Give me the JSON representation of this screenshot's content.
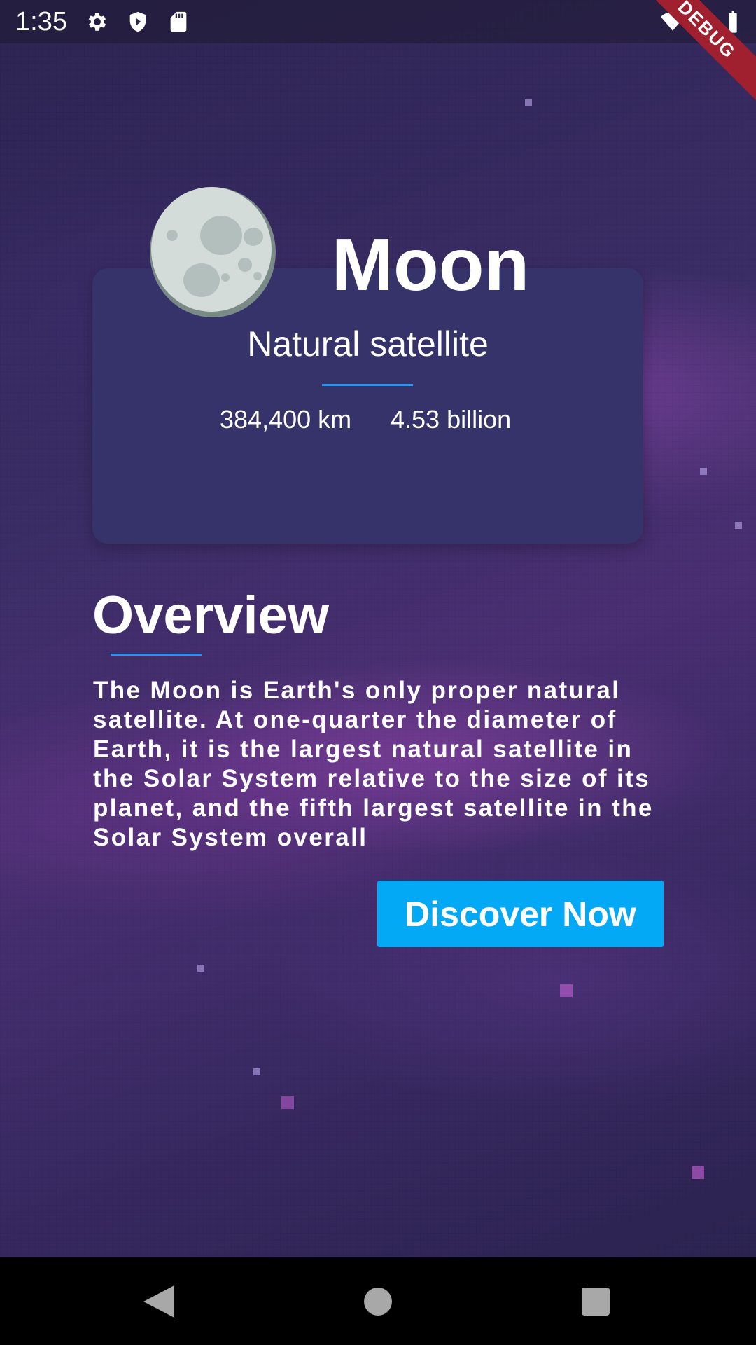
{
  "status_bar": {
    "time": "1:35",
    "icons": [
      "gear-icon",
      "shield-icon",
      "sd-card-icon",
      "wifi-icon",
      "signal-icon",
      "battery-icon"
    ],
    "debug_label": "DEBUG"
  },
  "planet": {
    "name": "Moon",
    "subtitle": "Natural satellite",
    "distance": "384,400 km",
    "age": "4.53 billion",
    "image": "moon-icon"
  },
  "overview": {
    "title": "Overview",
    "text": "The Moon is Earth's only proper natural satellite. At one-quarter the diameter of Earth, it is the largest natural satellite in the Solar System relative to the size of its planet, and the fifth largest satellite in the Solar System overall"
  },
  "actions": {
    "discover_label": "Discover Now"
  },
  "colors": {
    "accent": "#03a9f4",
    "divider": "#2196f3",
    "card": "#35336a",
    "debug": "#a0202f"
  },
  "nav": {
    "icons": [
      "back-icon",
      "home-icon",
      "recents-icon"
    ]
  }
}
